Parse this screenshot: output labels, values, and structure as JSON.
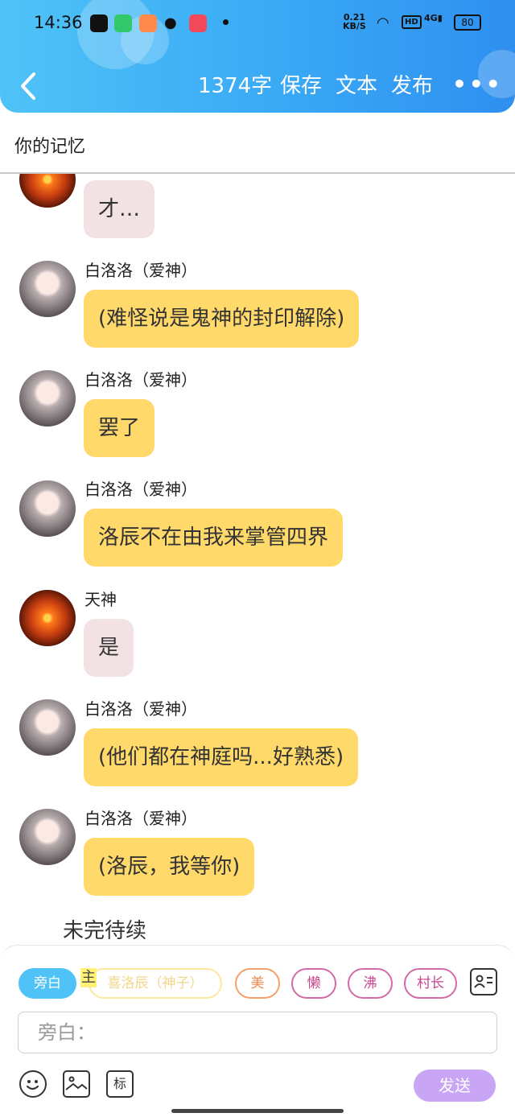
{
  "status_bar": {
    "time": "14:36",
    "net_speed_value": "0.21",
    "net_speed_unit": "KB/S",
    "hd": "HD",
    "signal": "4G",
    "battery": "80"
  },
  "header": {
    "word_count": "1374字",
    "save": "保存",
    "text": "文本",
    "publish": "发布",
    "more": "•••"
  },
  "title": "你的记忆",
  "chat": {
    "messages": [
      {
        "sender": "",
        "text": "才…",
        "style": "pink",
        "avatar": "sunset"
      },
      {
        "sender": "白洛洛（爱神）",
        "text": "(难怪说是鬼神的封印解除)",
        "style": "yellow",
        "avatar": "girl"
      },
      {
        "sender": "白洛洛（爱神）",
        "text": "罢了",
        "style": "yellow",
        "avatar": "girl"
      },
      {
        "sender": "白洛洛（爱神）",
        "text": "洛辰不在由我来掌管四界",
        "style": "yellow",
        "avatar": "girl"
      },
      {
        "sender": "天神",
        "text": "是",
        "style": "pink",
        "avatar": "sunset"
      },
      {
        "sender": "白洛洛（爱神）",
        "text": "(他们都在神庭吗...好熟悉)",
        "style": "yellow",
        "avatar": "girl"
      },
      {
        "sender": "白洛洛（爱神）",
        "text": "(洛辰，我等你)",
        "style": "yellow",
        "avatar": "girl"
      }
    ],
    "narration": "未完待续"
  },
  "composer": {
    "roles": [
      "旁白",
      "主",
      "喜洛辰（神子）",
      "美",
      "懒",
      "沸",
      "村长"
    ],
    "input_placeholder": "旁白：",
    "tag_label": "标",
    "send": "发送"
  },
  "colors": {
    "header_blue": "#39a9f5",
    "bubble_yellow": "#ffd96a",
    "bubble_pink": "#f3e2e3",
    "send_purple": "#c9a6f5"
  }
}
